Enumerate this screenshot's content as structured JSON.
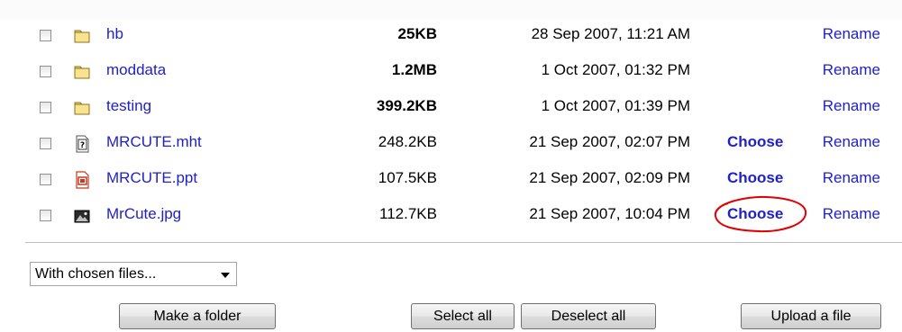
{
  "files": [
    {
      "icon": "folder-icon",
      "name": "hb",
      "size": "25KB",
      "date": "28 Sep 2007, 11:21 AM",
      "choose": "",
      "rename": "Rename"
    },
    {
      "icon": "folder-icon",
      "name": "moddata",
      "size": "1.2MB",
      "date": "1 Oct 2007, 01:32 PM",
      "choose": "",
      "rename": "Rename"
    },
    {
      "icon": "folder-icon",
      "name": "testing",
      "size": "399.2KB",
      "date": "1 Oct 2007, 01:39 PM",
      "choose": "",
      "rename": "Rename"
    },
    {
      "icon": "unknown-file-icon",
      "name": "MRCUTE.mht",
      "size": "248.2KB",
      "date": "21 Sep 2007, 02:07 PM",
      "choose": "Choose",
      "rename": "Rename"
    },
    {
      "icon": "powerpoint-file-icon",
      "name": "MRCUTE.ppt",
      "size": "107.5KB",
      "date": "21 Sep 2007, 02:09 PM",
      "choose": "Choose",
      "rename": "Rename"
    },
    {
      "icon": "image-file-icon",
      "name": "MrCute.jpg",
      "size": "112.7KB",
      "date": "21 Sep 2007, 10:04 PM",
      "choose": "Choose",
      "rename": "Rename"
    }
  ],
  "actions": {
    "with_chosen": "With chosen files...",
    "make_folder": "Make a folder",
    "select_all": "Select all",
    "deselect_all": "Deselect all",
    "upload": "Upload a file"
  },
  "colors": {
    "link": "#2020cc",
    "annotation": "#e00000",
    "folder_fill": "#f9e38e",
    "ppt_red": "#c43b1d"
  }
}
